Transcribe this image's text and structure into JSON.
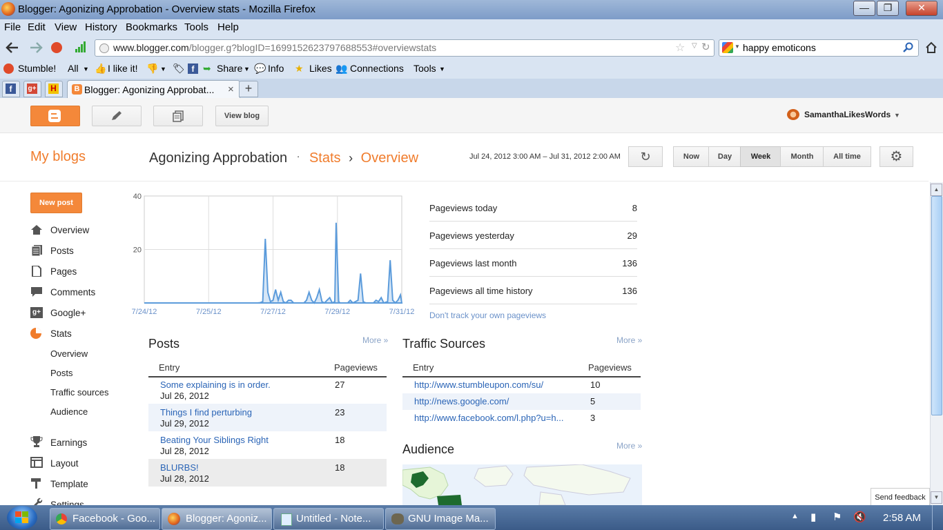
{
  "window": {
    "title": "Blogger: Agonizing Approbation - Overview stats - Mozilla Firefox",
    "btn_min": "—",
    "btn_max": "❐",
    "btn_close": "✕"
  },
  "menu": [
    "File",
    "Edit",
    "View",
    "History",
    "Bookmarks",
    "Tools",
    "Help"
  ],
  "nav": {
    "url_host": "www.blogger.com",
    "url_path": "/blogger.g?blogID=1699152623797688553#overviewstats",
    "search_text": "happy emoticons"
  },
  "toolbar": {
    "stumble": "Stumble!",
    "all": "All",
    "ilike": "I like it!",
    "share": "Share",
    "info": "Info",
    "likes": "Likes",
    "connections": "Connections",
    "tools": "Tools"
  },
  "tabs": {
    "active_title": "Blogger: Agonizing Approbat...",
    "close": "×",
    "new_tab": "+"
  },
  "blogger_header": {
    "view_blog": "View blog",
    "user": "SamanthaLikesWords"
  },
  "title_row": {
    "my_blogs": "My blogs",
    "blog_name": "Agonizing Approbation",
    "dot": "·",
    "stats": "Stats",
    "sep": "›",
    "overview": "Overview",
    "date_range": "Jul 24, 2012 3:00 AM – Jul 31, 2012 2:00 AM",
    "ranges": [
      "Now",
      "Day",
      "Week",
      "Month",
      "All time"
    ],
    "active_range": "Week"
  },
  "sidebar": {
    "new_post": "New post",
    "items": [
      {
        "label": "Overview",
        "icon": "home-icon"
      },
      {
        "label": "Posts",
        "icon": "posts-icon"
      },
      {
        "label": "Pages",
        "icon": "pages-icon"
      },
      {
        "label": "Comments",
        "icon": "comment-icon"
      },
      {
        "label": "Google+",
        "icon": "googleplus-icon"
      },
      {
        "label": "Stats",
        "icon": "pie-chart-icon"
      }
    ],
    "stats_sub": [
      "Overview",
      "Posts",
      "Traffic sources",
      "Audience"
    ],
    "items2": [
      {
        "label": "Earnings",
        "icon": "trophy-icon"
      },
      {
        "label": "Layout",
        "icon": "layout-icon"
      },
      {
        "label": "Template",
        "icon": "template-icon"
      },
      {
        "label": "Settings",
        "icon": "wrench-icon"
      }
    ]
  },
  "chart_data": {
    "type": "line",
    "yticks": [
      "40",
      "20"
    ],
    "xticks": [
      "7/24/12",
      "7/25/12",
      "7/27/12",
      "7/29/12",
      "7/31/12"
    ],
    "ylim": [
      0,
      40
    ],
    "series_color": "#5b9bdb",
    "points": [
      [
        0,
        0
      ],
      [
        0.44,
        0
      ],
      [
        0.45,
        0.1
      ],
      [
        0.46,
        0.5
      ],
      [
        0.47,
        24
      ],
      [
        0.48,
        4
      ],
      [
        0.49,
        0.5
      ],
      [
        0.5,
        1
      ],
      [
        0.51,
        5
      ],
      [
        0.52,
        1
      ],
      [
        0.53,
        4
      ],
      [
        0.54,
        0.5
      ],
      [
        0.55,
        0
      ],
      [
        0.56,
        1
      ],
      [
        0.57,
        1
      ],
      [
        0.58,
        0
      ],
      [
        0.62,
        0
      ],
      [
        0.63,
        1
      ],
      [
        0.64,
        4
      ],
      [
        0.65,
        1
      ],
      [
        0.66,
        0
      ],
      [
        0.67,
        2
      ],
      [
        0.68,
        5
      ],
      [
        0.69,
        0.5
      ],
      [
        0.7,
        0
      ],
      [
        0.71,
        1
      ],
      [
        0.72,
        2
      ],
      [
        0.73,
        0
      ],
      [
        0.74,
        0.5
      ],
      [
        0.745,
        30
      ],
      [
        0.755,
        0.5
      ],
      [
        0.76,
        0
      ],
      [
        0.79,
        0
      ],
      [
        0.8,
        1
      ],
      [
        0.81,
        0
      ],
      [
        0.83,
        1
      ],
      [
        0.84,
        11
      ],
      [
        0.85,
        0.5
      ],
      [
        0.86,
        0
      ],
      [
        0.89,
        0
      ],
      [
        0.9,
        1
      ],
      [
        0.91,
        0.5
      ],
      [
        0.92,
        2
      ],
      [
        0.93,
        0
      ],
      [
        0.945,
        0.5
      ],
      [
        0.955,
        16
      ],
      [
        0.965,
        1
      ],
      [
        0.975,
        0
      ],
      [
        0.985,
        1
      ],
      [
        0.99,
        2
      ],
      [
        0.995,
        3
      ],
      [
        1.0,
        0
      ]
    ]
  },
  "pageviews": [
    {
      "label": "Pageviews today",
      "value": "8"
    },
    {
      "label": "Pageviews yesterday",
      "value": "29"
    },
    {
      "label": "Pageviews last month",
      "value": "136"
    },
    {
      "label": "Pageviews all time history",
      "value": "136"
    }
  ],
  "dont_track": "Don't track your own pageviews",
  "posts": {
    "title": "Posts",
    "more": "More »",
    "col_entry": "Entry",
    "col_pageviews": "Pageviews",
    "rows": [
      {
        "title": "Some explaining is in order.",
        "date": "Jul 26, 2012",
        "views": "27"
      },
      {
        "title": "Things I find perturbing",
        "date": "Jul 29, 2012",
        "views": "23"
      },
      {
        "title": "Beating Your Siblings Right",
        "date": "Jul 28, 2012",
        "views": "18"
      },
      {
        "title": "BLURBS!",
        "date": "Jul 28, 2012",
        "views": "18"
      }
    ]
  },
  "traffic": {
    "title": "Traffic Sources",
    "more": "More »",
    "col_entry": "Entry",
    "col_pageviews": "Pageviews",
    "rows": [
      {
        "url": "http://www.stumbleupon.com/su/",
        "views": "10"
      },
      {
        "url": "http://news.google.com/",
        "views": "5"
      },
      {
        "url": "http://www.facebook.com/l.php?u=h...",
        "views": "3"
      }
    ]
  },
  "audience": {
    "title": "Audience",
    "more": "More »"
  },
  "feedback": "Send feedback",
  "taskbar": {
    "tasks": [
      "Facebook - Goo...",
      "Blogger: Agoniz...",
      "Untitled - Note...",
      "GNU Image Ma..."
    ],
    "time": "2:58 AM"
  }
}
